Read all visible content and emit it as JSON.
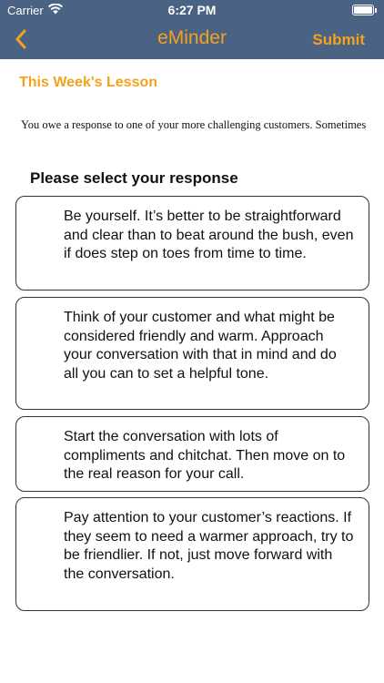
{
  "status_bar": {
    "carrier": "Carrier",
    "time": "6:27 PM",
    "battery_level": 1.0
  },
  "nav": {
    "back_icon": "chevron-left-icon",
    "title": "eMinder",
    "submit_label": "Submit"
  },
  "lesson": {
    "title": "This Week's Lesson",
    "text": "You owe a response to one of your more challenging customers.  Sometimes"
  },
  "prompt": "Please select your response",
  "options": [
    {
      "text": "Be yourself.  It’s better to be straightforward and clear than to beat around the bush, even if does step on toes from time to time."
    },
    {
      "text": "Think of your customer and what might be considered friendly and warm. Approach your conversation with that in mind and do all you can to set a helpful tone."
    },
    {
      "text": "Start the conversation with lots of compliments and chitchat.  Then move on to the real reason for your call."
    },
    {
      "text": "Pay attention to your customer’s reactions.  If they seem to need a warmer approach, try to be friendlier.  If not, just move forward with the conversation."
    }
  ],
  "colors": {
    "header_bg": "#4a6284",
    "accent": "#f4a21a"
  }
}
